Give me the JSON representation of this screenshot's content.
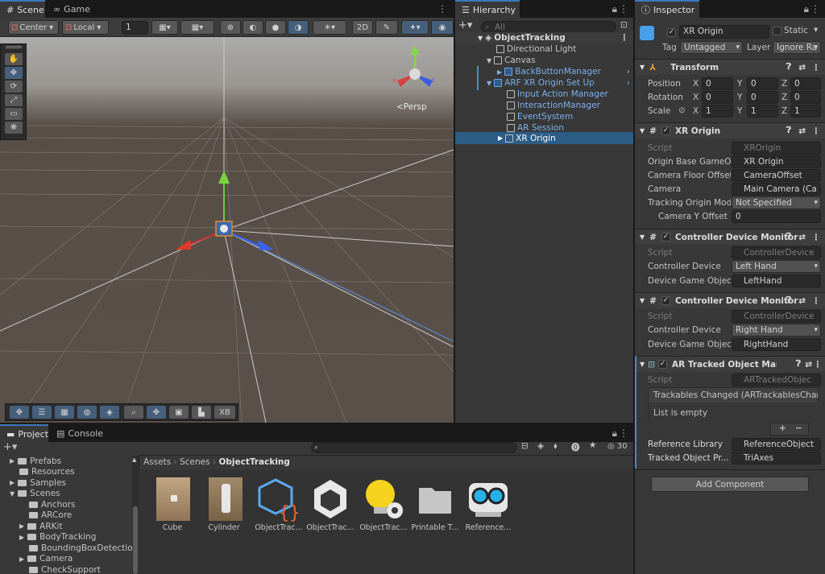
{
  "scene_panel": {
    "tabs": [
      {
        "label": "Scene"
      },
      {
        "label": "Game"
      }
    ],
    "toolbar": {
      "pivot_center": "Center",
      "pivot_local": "Local",
      "snap_value": "1"
    },
    "gizmo_persp": "<Persp",
    "bottom_toolbar_xb": "XB"
  },
  "hierarchy": {
    "tab_label": "Hierarchy",
    "search_placeholder": "All",
    "items": [
      {
        "label": "ObjectTracking"
      },
      {
        "label": "Directional Light"
      },
      {
        "label": "Canvas"
      },
      {
        "label": "BackButtonManager"
      },
      {
        "label": "ARF XR Origin Set Up"
      },
      {
        "label": "Input Action Manager"
      },
      {
        "label": "InteractionManager"
      },
      {
        "label": "EventSystem"
      },
      {
        "label": "AR Session"
      },
      {
        "label": "XR Origin"
      }
    ]
  },
  "inspector": {
    "tab_label": "Inspector",
    "object_name": "XR Origin",
    "static_label": "Static",
    "tag_label": "Tag",
    "tag_value": "Untagged",
    "layer_label": "Layer",
    "layer_value": "Ignore Ra",
    "transform": {
      "title": "Transform",
      "position_label": "Position",
      "rotation_label": "Rotation",
      "scale_label": "Scale",
      "axis_x": "X",
      "axis_y": "Y",
      "axis_z": "Z",
      "position": [
        "0",
        "0",
        "0"
      ],
      "rotation": [
        "0",
        "0",
        "0"
      ],
      "scale": [
        "1",
        "1",
        "1"
      ]
    },
    "xr_origin": {
      "title": "XR Origin",
      "script_label": "Script",
      "script_value": "XROrigin",
      "origin_base_label": "Origin Base GameOb",
      "origin_base_value": "XR Origin",
      "camera_floor_label": "Camera Floor Offset",
      "camera_floor_value": "CameraOffset",
      "camera_label": "Camera",
      "camera_value": "Main Camera (Ca",
      "tracking_mode_label": "Tracking Origin Mode",
      "tracking_mode_value": "Not Specified",
      "camera_y_label": "Camera Y Offset",
      "camera_y_value": "0"
    },
    "controller_left": {
      "title": "Controller Device Monitor",
      "script_label": "Script",
      "script_value": "ControllerDevice",
      "device_label": "Controller Device",
      "device_value": "Left Hand",
      "game_object_label": "Device Game Object",
      "game_object_value": "LeftHand"
    },
    "controller_right": {
      "title": "Controller Device Monitor",
      "script_label": "Script",
      "script_value": "ControllerDevice",
      "device_label": "Controller Device",
      "device_value": "Right Hand",
      "game_object_label": "Device Game Object",
      "game_object_value": "RightHand"
    },
    "ar_tracked": {
      "title": "AR Tracked Object Manag",
      "script_label": "Script",
      "script_value": "ARTrackedObjec",
      "event_title": "Trackables Changed (ARTrackablesChange",
      "event_body": "List is empty",
      "plus": "+",
      "minus": "−",
      "ref_lib_label": "Reference Library",
      "ref_lib_value": "ReferenceObject",
      "prefab_label": "Tracked Object Pr...",
      "prefab_value": "TriAxes"
    },
    "add_component": "Add Component"
  },
  "project": {
    "tabs": [
      {
        "label": "Project"
      },
      {
        "label": "Console"
      }
    ],
    "hidden_count": "30",
    "breadcrumb": [
      "Assets",
      "Scenes",
      "ObjectTracking"
    ],
    "tree": [
      {
        "label": "Prefabs"
      },
      {
        "label": "Resources"
      },
      {
        "label": "Samples"
      },
      {
        "label": "Scenes"
      },
      {
        "label": "Anchors"
      },
      {
        "label": "ARCore"
      },
      {
        "label": "ARKit"
      },
      {
        "label": "BodyTracking"
      },
      {
        "label": "BoundingBoxDetection"
      },
      {
        "label": "Camera"
      },
      {
        "label": "CheckSupport"
      }
    ],
    "assets": [
      {
        "label": "Cube"
      },
      {
        "label": "Cylinder"
      },
      {
        "label": "ObjectTrac..."
      },
      {
        "label": "ObjectTrac..."
      },
      {
        "label": "ObjectTrac..."
      },
      {
        "label": "Printable T..."
      },
      {
        "label": "Reference..."
      }
    ]
  }
}
